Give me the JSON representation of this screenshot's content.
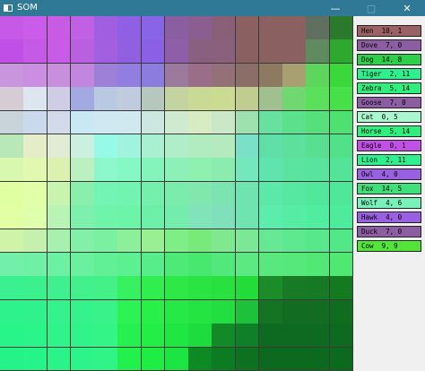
{
  "window": {
    "title": "SOM",
    "icon": "window-app-icon",
    "controls": {
      "minimize": "—",
      "maximize": "▢",
      "close": "✕"
    }
  },
  "som_grid": {
    "rows": 15,
    "cols": 15,
    "cells": [
      [
        "#c45ae6",
        "#c95ce8",
        "#c85be4",
        "#c060e4",
        "#9f5fe0",
        "#8f60e4",
        "#8864e6",
        "#8a5ea0",
        "#8a5e8e",
        "#8a5f78",
        "#8a6060",
        "#8a6060",
        "#8a6060",
        "#607060",
        "#2b7a2b"
      ],
      [
        "#c04fe8",
        "#c55ae6",
        "#c85ce6",
        "#b860e0",
        "#a060e0",
        "#9060e0",
        "#8a60e4",
        "#8e5ea8",
        "#8a6080",
        "#8a607c",
        "#8a6060",
        "#8a6060",
        "#8a6060",
        "#608a60",
        "#2ea82e"
      ],
      [
        "#c896dc",
        "#cc8ee0",
        "#c890dc",
        "#c386df",
        "#9f80d8",
        "#927ee0",
        "#8c7ce0",
        "#9c7a9e",
        "#9a6e88",
        "#947078",
        "#8c6e68",
        "#8e7a60",
        "#a8a070",
        "#5ed65e",
        "#3ad83a"
      ],
      [
        "#d6ccd6",
        "#dde5ee",
        "#cfcde6",
        "#a3a9e3",
        "#b9c9e2",
        "#c0ccde",
        "#b6c7be",
        "#c3d4a0",
        "#c8da94",
        "#cbdb91",
        "#c0cc90",
        "#a0c090",
        "#70d870",
        "#5ae05a",
        "#48e048"
      ],
      [
        "#c8d4da",
        "#cad9ec",
        "#d3dbea",
        "#c8e8f4",
        "#d0e8f2",
        "#d0e8f0",
        "#cce6e0",
        "#d0ead0",
        "#d8ecc4",
        "#cbe7c7",
        "#9ee0ae",
        "#68e0a0",
        "#5ce08c",
        "#56e07c",
        "#4ee070"
      ],
      [
        "#b8e8b8",
        "#e4ecc8",
        "#e0ecd4",
        "#ccf0e0",
        "#96fae6",
        "#a0f4de",
        "#a8f0d0",
        "#b0eeca",
        "#b0ecc0",
        "#b4eabe",
        "#7ae0c8",
        "#60e0a8",
        "#5ce09c",
        "#58e090",
        "#52e088"
      ],
      [
        "#d8f8b0",
        "#e0f8b0",
        "#dcf0b0",
        "#bcf0c0",
        "#8cf8cc",
        "#86f8c6",
        "#84f4bc",
        "#8cf0b8",
        "#90f0b0",
        "#8cecb0",
        "#74e8bc",
        "#5ee4ac",
        "#5ae4a0",
        "#58e49c",
        "#54e498"
      ],
      [
        "#e0ffa0",
        "#e0ffa8",
        "#c8f4b0",
        "#88f0ac",
        "#74f4b4",
        "#70f4b0",
        "#74f0ac",
        "#7cecac",
        "#80e8ac",
        "#7ce4b0",
        "#70e4b0",
        "#5ce8a8",
        "#56e8a0",
        "#52e89c",
        "#4ee898"
      ],
      [
        "#e2ffa4",
        "#e0ffac",
        "#b8f4b4",
        "#7cf0ac",
        "#70f4ac",
        "#6cf4a8",
        "#6cf0a8",
        "#74ecac",
        "#80e4b8",
        "#80e0bc",
        "#70e4b0",
        "#5cecac",
        "#56eca4",
        "#50eca0",
        "#4cec9c"
      ],
      [
        "#cff4a8",
        "#c6f0ae",
        "#a8f0ae",
        "#82f0a6",
        "#7af0a0",
        "#8cf09a",
        "#98f092",
        "#80ee86",
        "#78ea7c",
        "#80e88e",
        "#7ce896",
        "#66e894",
        "#5ee890",
        "#58e88c",
        "#52e888"
      ],
      [
        "#72f0aa",
        "#70f0a6",
        "#6cf0a2",
        "#6af09e",
        "#62f096",
        "#5cf092",
        "#56ee8a",
        "#4eea78",
        "#48e870",
        "#52e87c",
        "#5ce882",
        "#5ae87e",
        "#56e87a",
        "#52e876",
        "#4ee872"
      ],
      [
        "#3af090",
        "#3cf08e",
        "#40f08e",
        "#42f08c",
        "#44f088",
        "#36f060",
        "#30ee50",
        "#2ee848",
        "#2ae444",
        "#28e040",
        "#22dc3a",
        "#1a8c28",
        "#187a24",
        "#167a24",
        "#147a20"
      ],
      [
        "#2ef28c",
        "#30f28c",
        "#34f28c",
        "#36f28c",
        "#3af28a",
        "#2cf254",
        "#28f048",
        "#26e846",
        "#24e444",
        "#22de40",
        "#1ec23a",
        "#147424",
        "#126c22",
        "#126c22",
        "#106c1e"
      ],
      [
        "#28f48a",
        "#2af48a",
        "#2ef48a",
        "#30f48a",
        "#34f488",
        "#26f050",
        "#22ee46",
        "#20e644",
        "#1cdc3e",
        "#128a28",
        "#108028",
        "#0e6a20",
        "#0e6a20",
        "#0e6a20",
        "#0e6a20"
      ],
      [
        "#24f488",
        "#26f488",
        "#2af488",
        "#2cf488",
        "#30f486",
        "#22f04c",
        "#1eee44",
        "#1ce442",
        "#0e8a24",
        "#0c7c22",
        "#0c721f",
        "#0c6a1e",
        "#0c6a1e",
        "#0c6a1e",
        "#0c6a1e"
      ]
    ]
  },
  "legend": [
    {
      "label": "Hen  10, 1",
      "color": "#9a6262"
    },
    {
      "label": "Dove  7, 0",
      "color": "#8d5da2"
    },
    {
      "label": "Dog  14, 8",
      "color": "#2ecf4a"
    },
    {
      "label": "Tiger  2, 11",
      "color": "#2ef08e"
    },
    {
      "label": "Zebra  5, 14",
      "color": "#2ef07e"
    },
    {
      "label": "Goose  7, 0",
      "color": "#8d5da2"
    },
    {
      "label": "Cat  0, 5",
      "color": "#a9f6cf"
    },
    {
      "label": "Horse  5, 14",
      "color": "#2ef07e"
    },
    {
      "label": "Eagle  0, 1",
      "color": "#c24fe6"
    },
    {
      "label": "Lion  2, 11",
      "color": "#2ef08e"
    },
    {
      "label": "Owl  4, 0",
      "color": "#9960e2"
    },
    {
      "label": "Fox  14, 5",
      "color": "#3fe07a"
    },
    {
      "label": "Wolf  4, 6",
      "color": "#78f2b8"
    },
    {
      "label": "Hawk  4, 0",
      "color": "#9960e2"
    },
    {
      "label": "Duck  7, 0",
      "color": "#8d5da2"
    },
    {
      "label": "Cow  9, 9",
      "color": "#52e436"
    }
  ]
}
